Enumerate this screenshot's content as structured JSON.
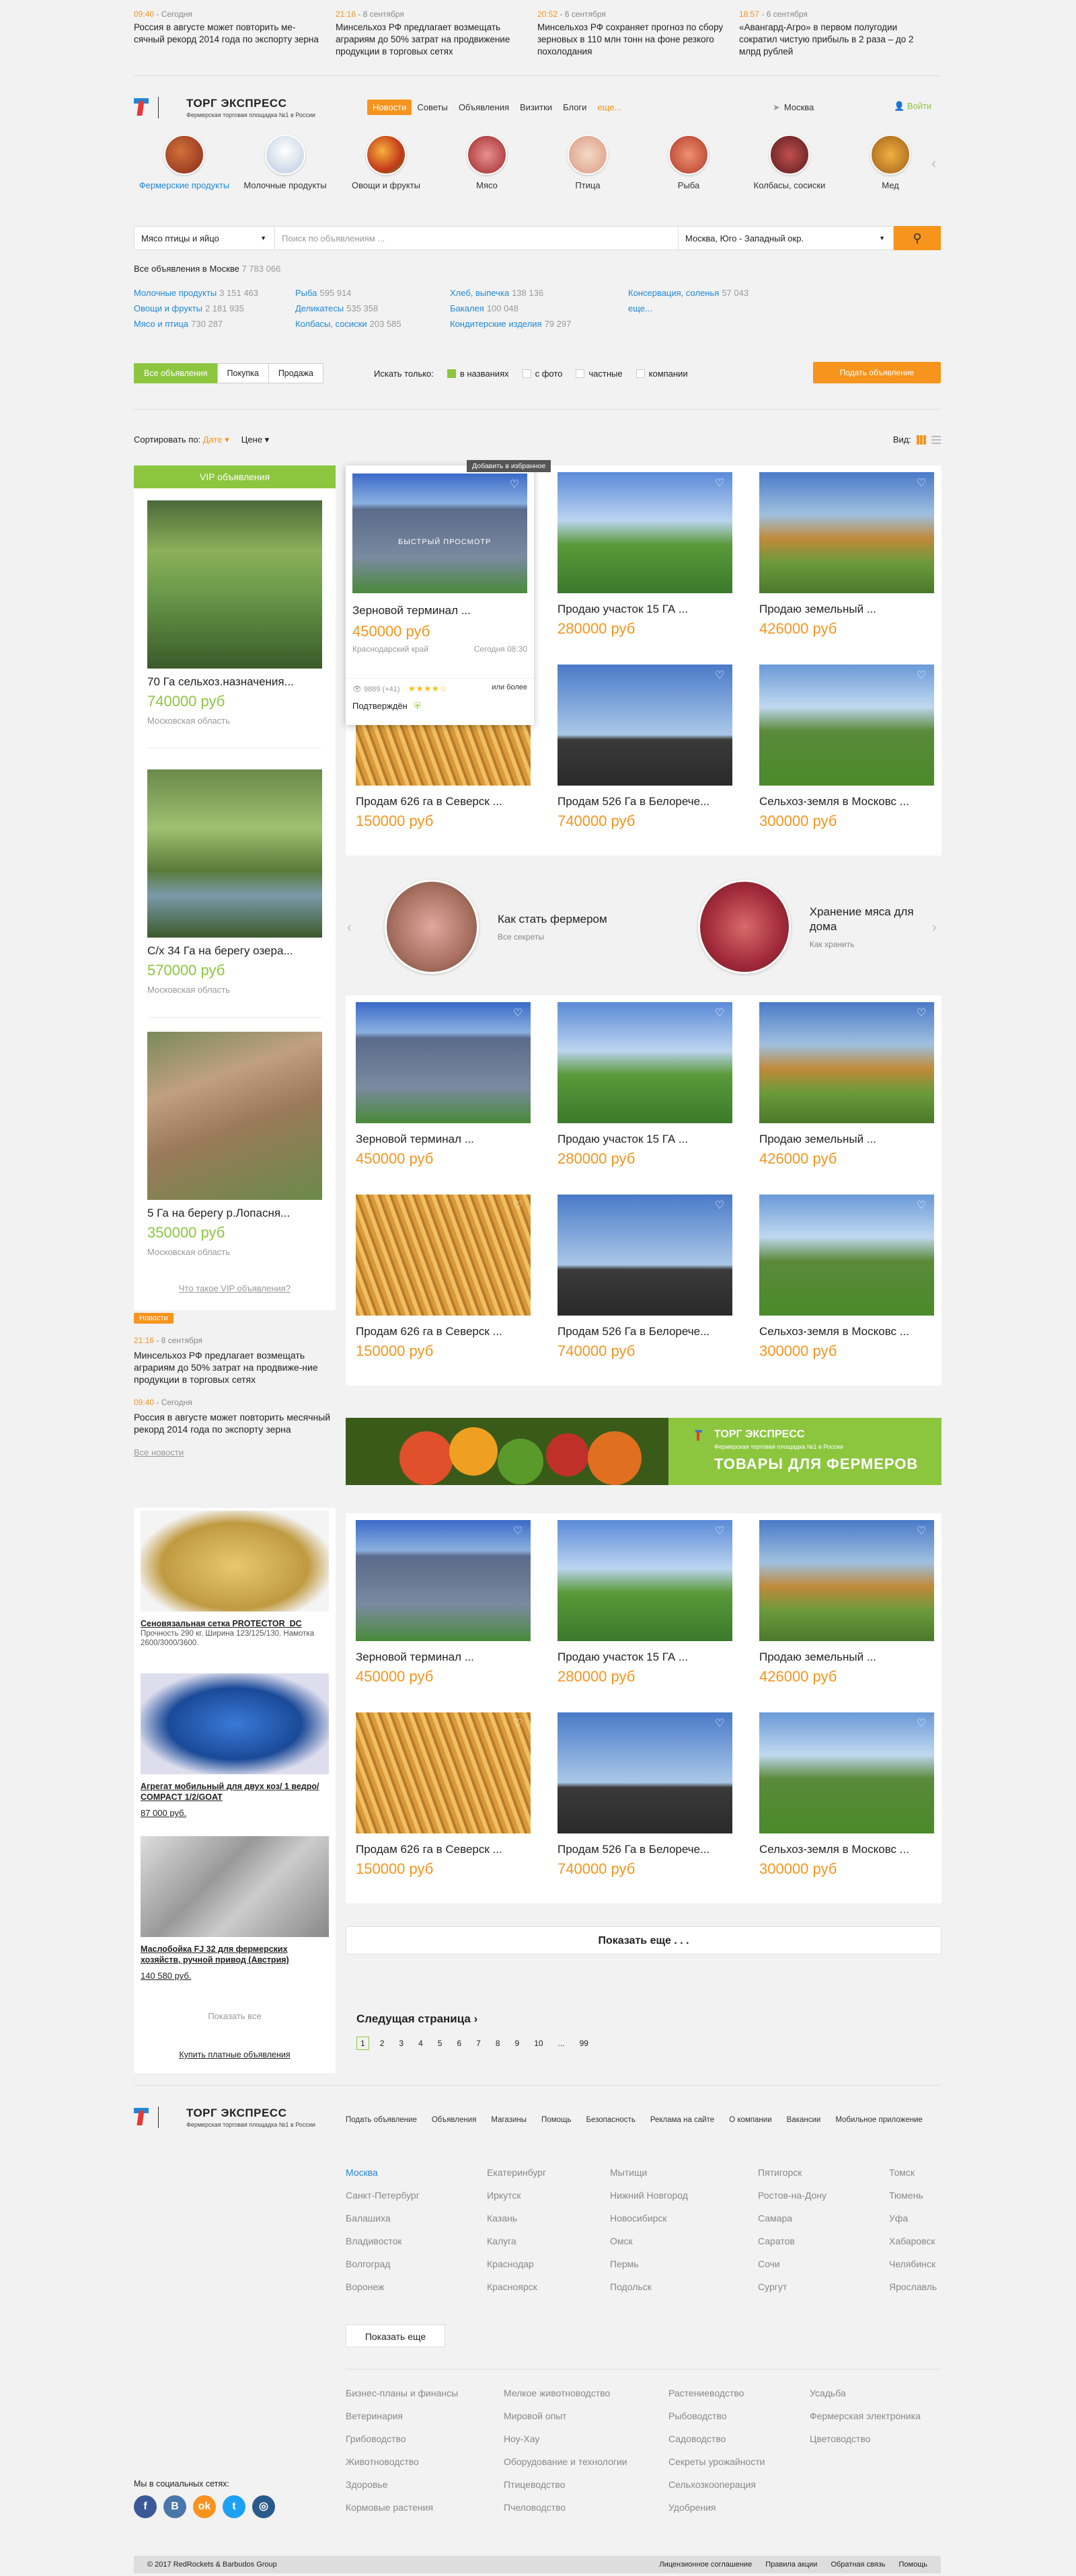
{
  "top_news": [
    {
      "time": "09:40",
      "date": "Сегодня",
      "text": "Россия в августе может повторить ме-сячный рекорд 2014 года по экспорту зерна"
    },
    {
      "time": "21:16",
      "date": "8 сентября",
      "text": "Минсельхоз РФ предлагает возмещать аграриям до 50% затрат на продвижение продукции в торговых сетях"
    },
    {
      "time": "20:52",
      "date": "6 сентября",
      "text": "Минсельхоз РФ сохраняет прогноз по сбору зерновых в 110 млн тонн на фоне резкого похолодания"
    },
    {
      "time": "18:57",
      "date": "6 сентября",
      "text": "«Авангард-Агро» в первом полугодии сократил чистую прибыль в 2 раза – до 2 млрд рублей"
    }
  ],
  "brand": {
    "name": "ТОРГ ЭКСПРЕСС",
    "tagline": "Фермерская торговая площадка №1 в России"
  },
  "nav": {
    "items": [
      "Новости",
      "Советы",
      "Объявления",
      "Визитки",
      "Блоги"
    ],
    "more": "еще...",
    "city": "Москва",
    "login": "Войти"
  },
  "categories": [
    {
      "label": "Фермерские продукты",
      "color": "#b5452a"
    },
    {
      "label": "Молочные продукты",
      "color": "#c8d6e8"
    },
    {
      "label": "Овощи и фрукты",
      "color": "#e07a1f"
    },
    {
      "label": "Мясо",
      "color": "#b83a3a"
    },
    {
      "label": "Птица",
      "color": "#e8b9a0"
    },
    {
      "label": "Рыба",
      "color": "#c0503a"
    },
    {
      "label": "Колбасы, сосиски",
      "color": "#8a2a2a"
    },
    {
      "label": "Мед",
      "color": "#c98a1e"
    }
  ],
  "search": {
    "category": "Мясо птицы и яйцо",
    "placeholder": "Поиск по объявлениям ...",
    "region": "Москва, Юго - Западный окр."
  },
  "all_ads": {
    "label": "Все объявления в Москве",
    "count": "7 783 066"
  },
  "cat_links": [
    {
      "name": "Молочные продукты",
      "n": "3 151 463"
    },
    {
      "name": "Рыба",
      "n": "595 914"
    },
    {
      "name": "Хлеб, выпечка",
      "n": "138 136"
    },
    {
      "name": "Консервация, соленья",
      "n": "57 043"
    },
    {
      "name": "Овощи и фрукты",
      "n": "2 181 935"
    },
    {
      "name": "Деликатесы",
      "n": "535 358"
    },
    {
      "name": "Бакалея",
      "n": "100 048"
    },
    {
      "name": "еще...",
      "n": ""
    },
    {
      "name": "Мясо и птица",
      "n": "730 287"
    },
    {
      "name": "Колбасы, сосиски",
      "n": "203 585"
    },
    {
      "name": "Кондитерские изделия",
      "n": "79 297"
    }
  ],
  "filters": {
    "tabs": [
      "Все объявления",
      "Покупка",
      "Продажа"
    ],
    "only_label": "Искать только:",
    "checks": [
      "в названиях",
      "с фото",
      "частные",
      "компании"
    ],
    "post": "Подать объявление"
  },
  "sort": {
    "label": "Сортировать по:",
    "date": "Дате",
    "price": "Цене",
    "view": "Вид:"
  },
  "vip": {
    "title": "VIP объявления",
    "items": [
      {
        "title": "70 Га сельхоз.назначения...",
        "price": "740000 руб",
        "region": "Московская область"
      },
      {
        "title": "С/х 34 Га на берегу озера...",
        "price": "570000 руб",
        "region": "Московская область"
      },
      {
        "title": "5 Га на берегу р.Лопасня...",
        "price": "350000 руб",
        "region": "Московская область"
      }
    ],
    "link": "Что такое VIP объявления?"
  },
  "hover_card": {
    "tooltip": "Добавить в избранное",
    "fast": "БЫСТРЫЙ ПРОСМОТР",
    "title": "Зерновой терминал ...",
    "price": "450000 руб",
    "region": "Краснодарский край",
    "when": "Сегодня 08:30",
    "views": "9889 (+41)",
    "more": "или более",
    "confirmed": "Подтверждён"
  },
  "listing_a": [
    {
      "title": "Зерновой терминал ...",
      "price": "450000 руб"
    },
    {
      "title": "Продаю участок 15 ГА ...",
      "price": "280000 руб"
    },
    {
      "title": "Продаю земельный ...",
      "price": "426000 руб"
    },
    {
      "title": "Продам 626 га в Северск ...",
      "price": "150000 руб"
    },
    {
      "title": "Продам 526 Га в Белорече...",
      "price": "740000 руб"
    },
    {
      "title": "Сельхоз-земля в Московс ...",
      "price": "300000 руб"
    }
  ],
  "listing_b": [
    {
      "title": "Зерновой терминал ...",
      "price": "450000 руб"
    },
    {
      "title": "Продаю участок 15 ГА ...",
      "price": "280000 руб"
    },
    {
      "title": "Продаю земельный ...",
      "price": "426000 руб"
    },
    {
      "title": "Продам 626 га в Северск ...",
      "price": "150000 руб"
    },
    {
      "title": "Продам 526 Га в Белорече...",
      "price": "740000 руб"
    },
    {
      "title": "Сельхоз-земля в Московс ...",
      "price": "300000 руб"
    }
  ],
  "listing_c": [
    {
      "title": "Зерновой терминал ...",
      "price": "450000 руб"
    },
    {
      "title": "Продаю участок 15 ГА ...",
      "price": "280000 руб"
    },
    {
      "title": "Продаю земельный ...",
      "price": "426000 руб"
    },
    {
      "title": "Продам 626 га в Северск ...",
      "price": "150000 руб"
    },
    {
      "title": "Продам 526 Га в Белорече...",
      "price": "740000 руб"
    },
    {
      "title": "Сельхоз-земля в Московс ...",
      "price": "300000 руб"
    }
  ],
  "articles": [
    {
      "title": "Как стать фермером",
      "link": "Все секреты"
    },
    {
      "title": "Хранение мяса для дома",
      "link": "Как хранить"
    }
  ],
  "side_news": {
    "badge": "Новости",
    "items": [
      {
        "time": "21:16",
        "date": "8 сентября",
        "text": "Минсельхоз РФ предлагает возмещать аграриям до 50% затрат на продвиже-ние продукции в торговых сетях"
      },
      {
        "time": "09:40",
        "date": "Сегодня",
        "text": "Россия в августе может повторить месячный рекорд 2014 года по экспорту зерна"
      }
    ],
    "all": "Все новости"
  },
  "banner": {
    "name": "ТОРГ ЭКСПРЕСС",
    "tagline": "Фермерская торговая площадка №1 в России",
    "slogan": "ТОВАРЫ ДЛЯ ФЕРМЕРОВ"
  },
  "shop": {
    "items": [
      {
        "title": "Сеновязальная сетка PROTECTOR_DC",
        "desc": "Прочность 290 кг. Ширина 123/125/130. Намотка 2600/3000/3600.",
        "price": ""
      },
      {
        "title": "Агрегат мобильный для двух коз/ 1 ведро/ COMPACT 1/2/GOAT",
        "desc": "",
        "price": "87 000 руб."
      },
      {
        "title": "Маслобойка FJ 32 для фермерских хозяйств, ручной привод (Австрия)",
        "desc": "",
        "price": "140 580 руб."
      }
    ],
    "show_all": "Показать все",
    "paid": "Купить платные объявления"
  },
  "show_more": "Показать еще . . .",
  "next_page": "Следущая страница",
  "pages": [
    "1",
    "2",
    "3",
    "4",
    "5",
    "6",
    "7",
    "8",
    "9",
    "10",
    "...",
    "99"
  ],
  "footer": {
    "nav": [
      "Подать объявление",
      "Объявления",
      "Магазины",
      "Помощь",
      "Безопасность",
      "Реклама на сайте",
      "О компании",
      "Вакансии",
      "Мобильное приложение"
    ],
    "cities": [
      "Москва",
      "Екатеринбург",
      "Мытищи",
      "Пятигорск",
      "Томск",
      "Санкт-Петербург",
      "Иркутск",
      "Нижний Новгород",
      "Ростов-на-Дону",
      "Тюмень",
      "Балашиха",
      "Казань",
      "Новосибирск",
      "Самара",
      "Уфа",
      "Владивосток",
      "Калуга",
      "Омск",
      "Саратов",
      "Хабаровск",
      "Волгоград",
      "Краснодар",
      "Пермь",
      "Сочи",
      "Челябинск",
      "Воронеж",
      "Красноярск",
      "Подольск",
      "Сургут",
      "Ярославль"
    ],
    "show_more": "Показать еще",
    "topics": [
      "Бизнес-планы и финансы",
      "Мелкое животноводство",
      "Растениеводство",
      "Усадьба",
      "Ветеринария",
      "Мировой опыт",
      "Рыбоводство",
      "Фермерская электроника",
      "Грибоводство",
      "Ноу-Хау",
      "Садоводство",
      "Цветоводство",
      "Животноводство",
      "Оборудование и технологии",
      "Секреты урожайности",
      "",
      "Здоровье",
      "Птицеводство",
      "Сельхозкооперация",
      "",
      "Кормовые растения",
      "Пчеловодство",
      "Удобрения",
      ""
    ],
    "social_title": "Мы в социальных сетях:",
    "copyright": "© 2017 RedRockets & Barbudos Group",
    "links": [
      "Лицензионное соглашение",
      "Правила акции",
      "Обратная связь",
      "Помощь"
    ]
  }
}
